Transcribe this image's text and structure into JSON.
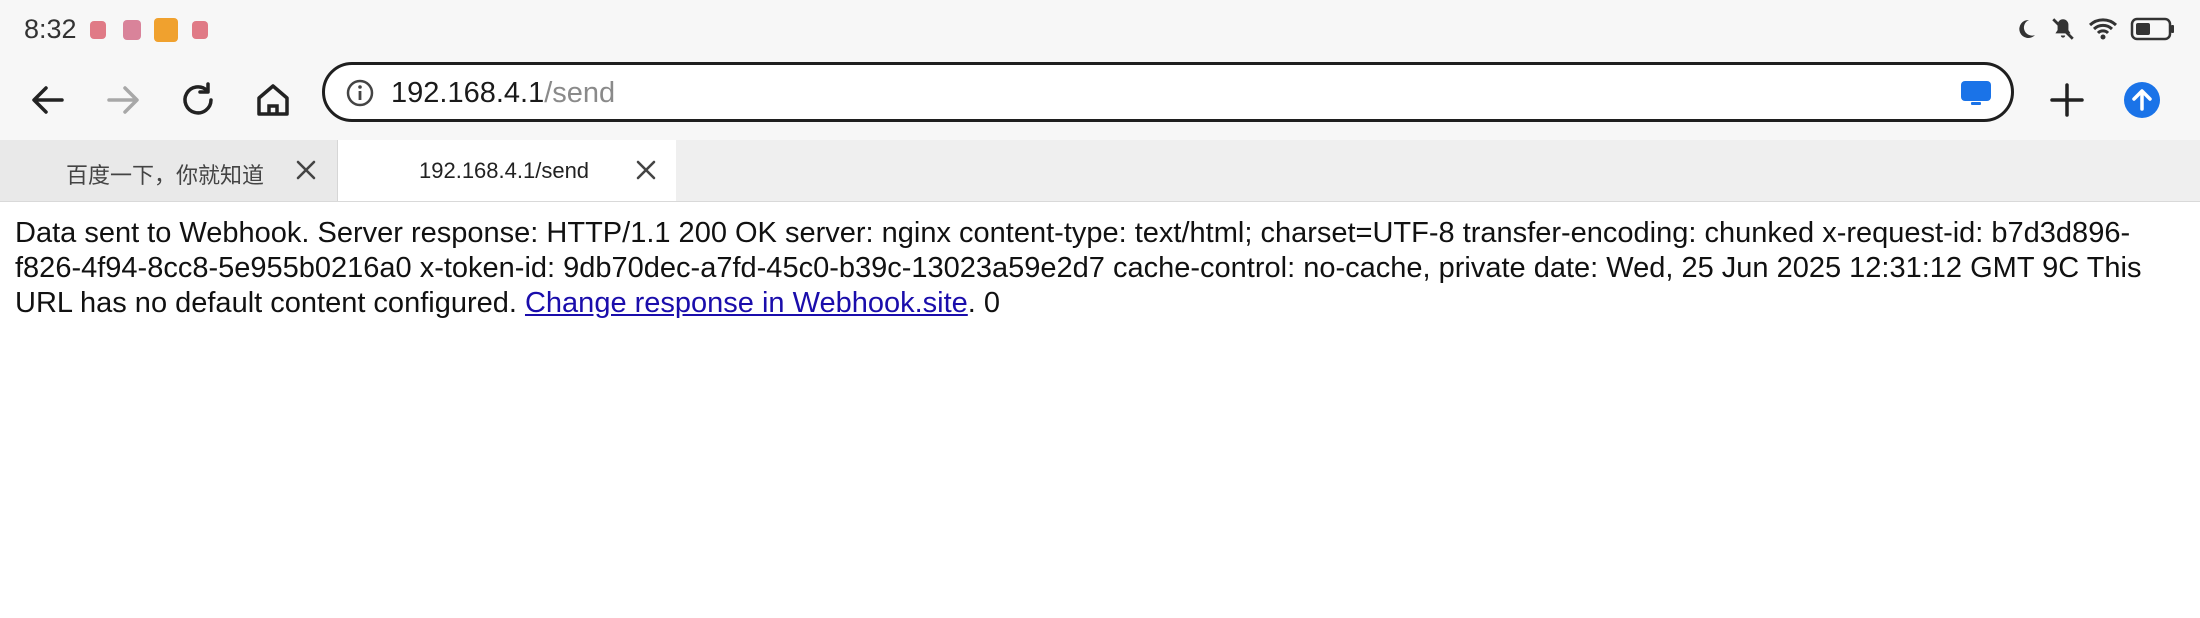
{
  "status_bar": {
    "time": "8:32",
    "notification_icons": [
      {
        "name": "app-notification-icon",
        "color": "#e07a86"
      },
      {
        "name": "app-notification-icon",
        "color": "#d9839a"
      },
      {
        "name": "app-notification-icon",
        "color": "#f0a12e"
      },
      {
        "name": "app-notification-icon",
        "color": "#e07a86"
      }
    ],
    "indicators": [
      "do-not-disturb-moon-icon",
      "mute-bell-icon",
      "wifi-icon",
      "battery-icon"
    ]
  },
  "toolbar": {
    "back_icon": "back-arrow-icon",
    "forward_icon": "forward-arrow-icon",
    "reload_icon": "reload-icon",
    "home_icon": "home-icon",
    "new_tab_icon": "plus-icon",
    "update_icon": "upload-arrow-icon",
    "update_color": "#1a73e8"
  },
  "address_bar": {
    "host": "192.168.4.1",
    "path": "/send",
    "action_color": "#1a73e8"
  },
  "tabs": [
    {
      "title": "百度一下，你就知道",
      "active": false
    },
    {
      "title": "192.168.4.1/send",
      "active": true
    }
  ],
  "content": {
    "body_text": "Data sent to Webhook. Server response: HTTP/1.1 200 OK server: nginx content-type: text/html; charset=UTF-8 transfer-encoding: chunked x-request-id: b7d3d896-f826-4f94-8cc8-5e955b0216a0 x-token-id: 9db70dec-a7fd-45c0-b39c-13023a59e2d7 cache-control: no-cache, private date: Wed, 25 Jun 2025 12:31:12 GMT 9C This URL has no default content configured. ",
    "link_text": "Change response in Webhook.site",
    "trailing_text": ". 0"
  }
}
